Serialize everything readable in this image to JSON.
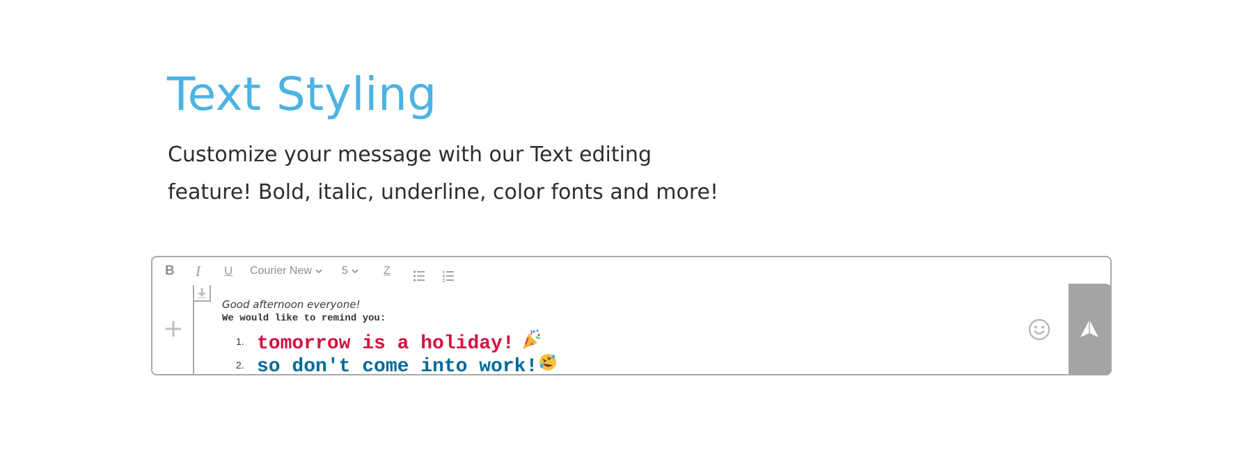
{
  "hero": {
    "title": "Text Styling",
    "desc_line1": "Customize your message with our Text editing",
    "desc_line2": "feature! Bold, italic, underline, color fonts and more!"
  },
  "toolbar": {
    "bold_label": "B",
    "italic_label": "I",
    "underline_label": "U",
    "font_family": "Courier New",
    "font_size": "5",
    "clear_format_label": "Z",
    "icons": [
      "chevron-down-icon",
      "bullet-list-icon",
      "numbered-list-icon"
    ]
  },
  "message": {
    "greeting": "Good afternoon everyone!",
    "remind": "We would like to remind you:",
    "items": [
      {
        "number": "1.",
        "text": "tomorrow is a holiday!",
        "emoji": "🎉",
        "color": "#d4123f"
      },
      {
        "number": "2.",
        "text": "so don't come into work!",
        "emoji": "🤣",
        "color": "#006a9a"
      }
    ]
  },
  "colors": {
    "title": "#4cb3e2",
    "border": "#a9a9ab",
    "send_button": "#a4a4a7",
    "icon_gray": "#9a9a9a"
  },
  "icons": {
    "add": "plus-icon",
    "collapse": "arrow-down-icon",
    "emoji_picker": "smiley-icon",
    "send": "send-icon"
  }
}
